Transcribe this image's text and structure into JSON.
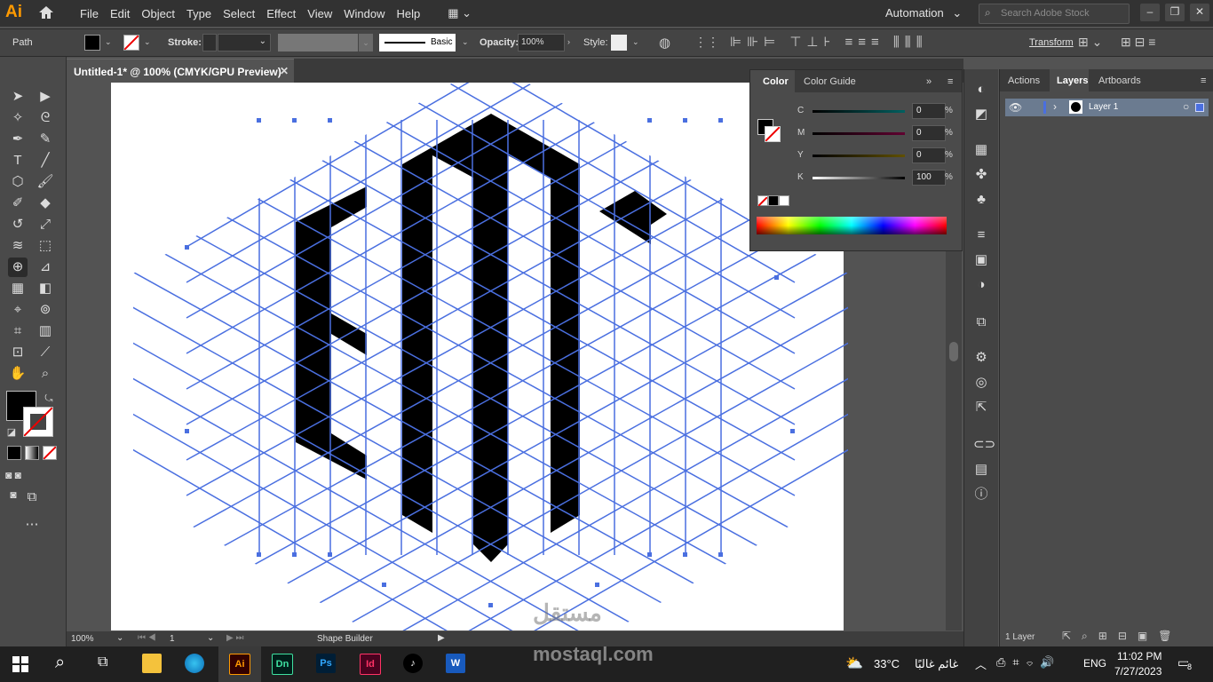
{
  "app": {
    "logo": "Ai"
  },
  "menu": [
    "File",
    "Edit",
    "Object",
    "Type",
    "Select",
    "Effect",
    "View",
    "Window",
    "Help"
  ],
  "workspace": "Automation",
  "search_placeholder": "Search Adobe Stock",
  "control": {
    "selection": "Path",
    "stroke_label": "Stroke:",
    "brush": "Basic",
    "opacity_label": "Opacity:",
    "opacity_value": "100%",
    "style_label": "Style:",
    "transform_label": "Transform"
  },
  "document": {
    "tab_title": "Untitled-1* @ 100% (CMYK/GPU Preview)"
  },
  "status": {
    "zoom": "100%",
    "artboard": "1",
    "tool": "Shape Builder"
  },
  "color_panel": {
    "tabs": [
      "Color",
      "Color Guide"
    ],
    "channels": [
      {
        "label": "C",
        "value": "0"
      },
      {
        "label": "M",
        "value": "0"
      },
      {
        "label": "Y",
        "value": "0"
      },
      {
        "label": "K",
        "value": "100"
      }
    ],
    "pct": "%"
  },
  "layers_panel": {
    "tabs": [
      "Actions",
      "Layers",
      "Artboards"
    ],
    "layer_name": "Layer 1",
    "footer_count": "1 Layer"
  },
  "taskbar": {
    "weather": "33°C",
    "weather_text": "غائم غالبًا",
    "lang": "ENG",
    "time": "11:02 PM",
    "date": "7/27/2023",
    "notifications": "8",
    "apps": [
      "Ai",
      "Dn",
      "Ps",
      "Id",
      "W"
    ]
  },
  "watermark": {
    "arabic": "مستقل",
    "url": "mostaql.com"
  },
  "colors": {
    "accent": "#4a6fe0",
    "ai_orange": "#ff9a00"
  }
}
